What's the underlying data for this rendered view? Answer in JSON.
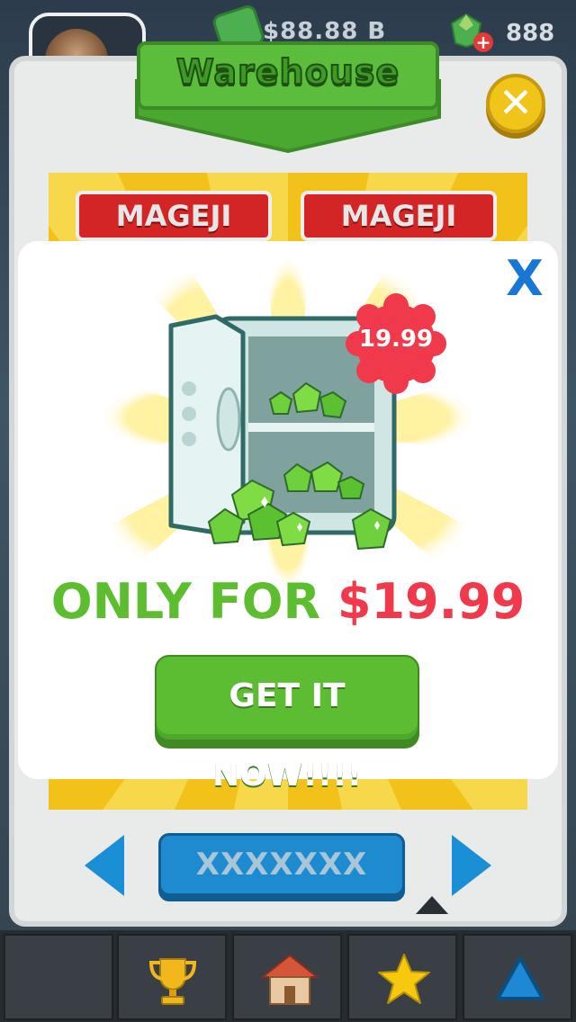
{
  "hud": {
    "cash": "$88.88 B",
    "gems": "888"
  },
  "warehouse": {
    "title": "Warehouse",
    "item_tags": [
      "MAGEJI",
      "MAGEJI"
    ],
    "item_name": "XXXXXXX"
  },
  "modal": {
    "close_label": "X",
    "price_badge": "19.99",
    "offer_prefix": "ONLY FOR",
    "offer_price": "$19.99",
    "cta_label": "GET IT NOW!!!!"
  },
  "colors": {
    "green": "#5cbe2f",
    "red": "#f0394a",
    "blue": "#1976d2",
    "yellow": "#f0c419"
  },
  "icons": {
    "bottom_bar": [
      "trophy-icon",
      "house-icon",
      "star-icon",
      "triangle-up-icon"
    ]
  }
}
